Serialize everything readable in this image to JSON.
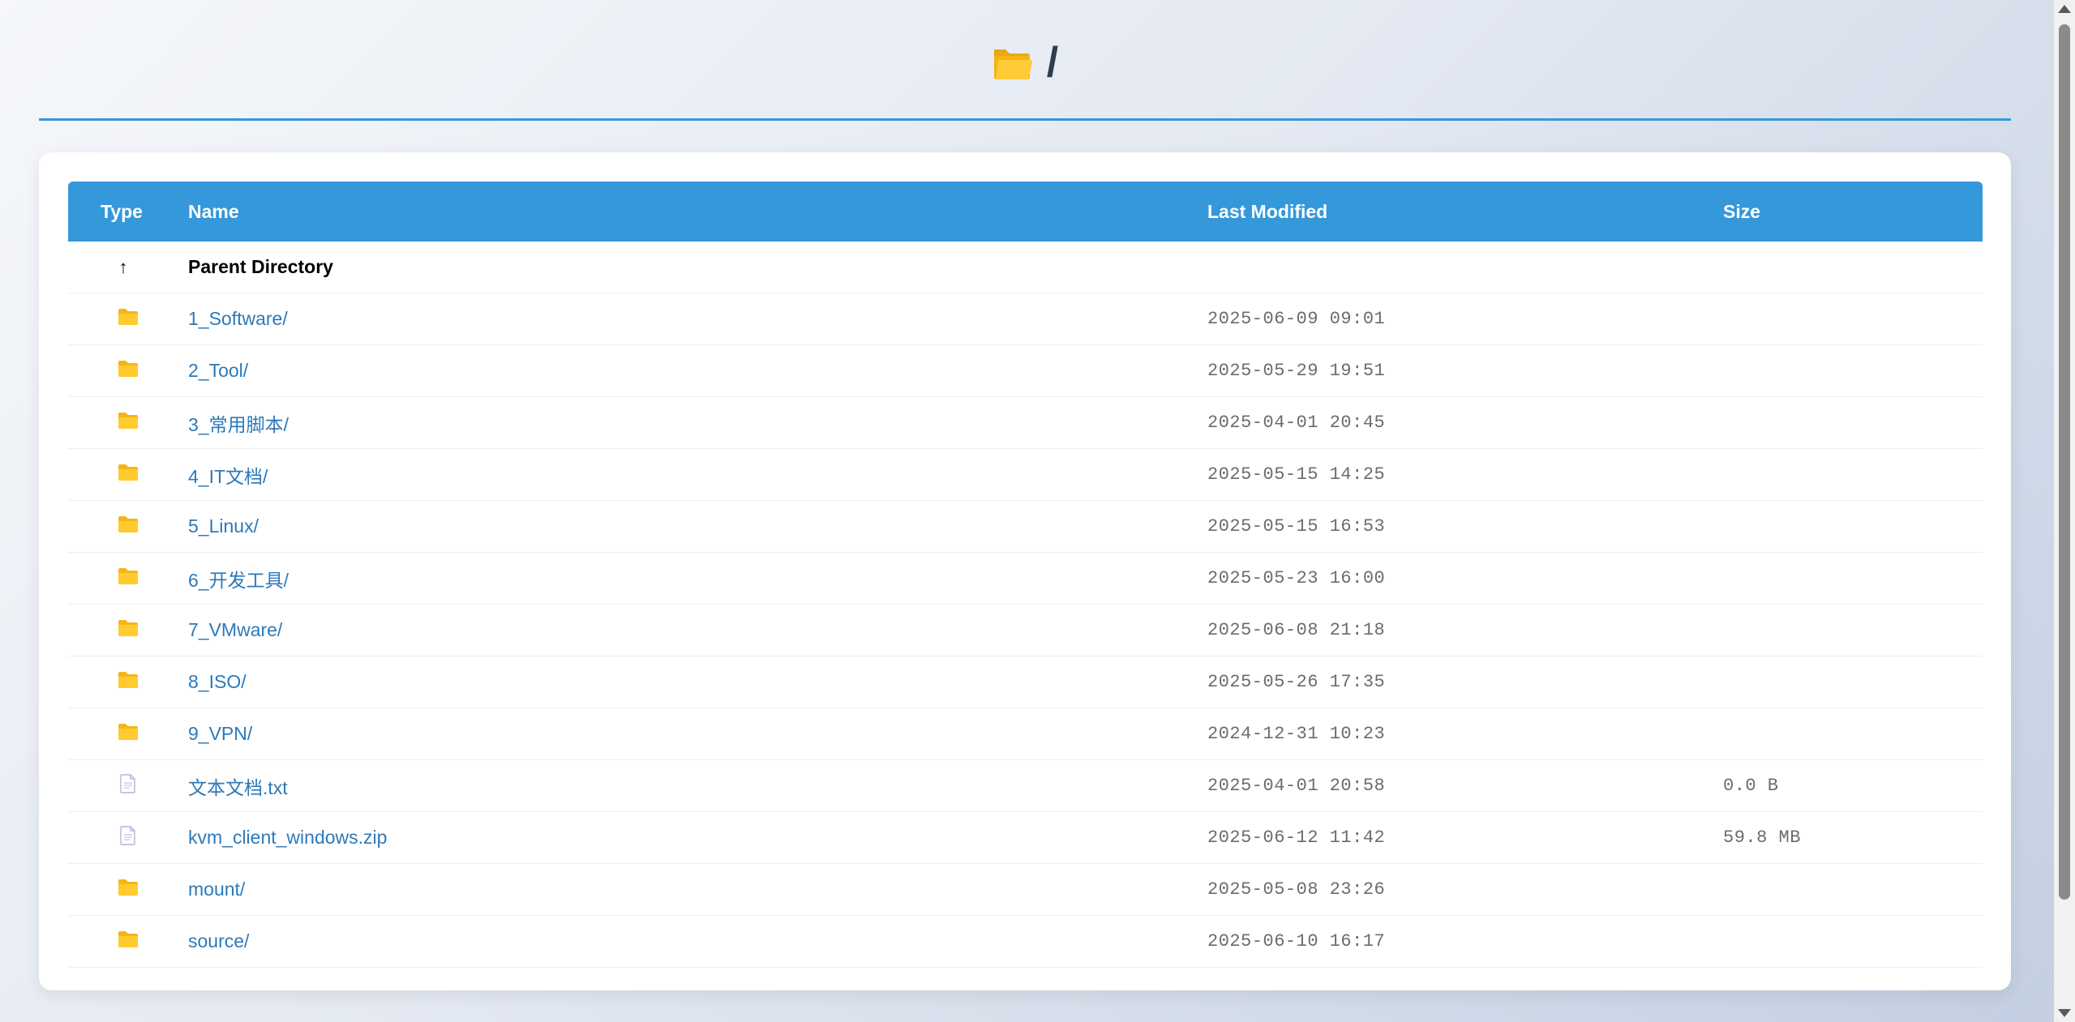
{
  "header": {
    "icon": "open-folder-icon",
    "title": "/"
  },
  "table": {
    "columns": {
      "type": "Type",
      "name": "Name",
      "modified": "Last Modified",
      "size": "Size"
    },
    "parent": {
      "icon": "↑",
      "label": "Parent Directory"
    },
    "rows": [
      {
        "icon": "folder-icon",
        "name": "1_Software/",
        "modified": "2025-06-09 09:01",
        "size": ""
      },
      {
        "icon": "folder-icon",
        "name": "2_Tool/",
        "modified": "2025-05-29 19:51",
        "size": ""
      },
      {
        "icon": "folder-icon",
        "name": "3_常用脚本/",
        "modified": "2025-04-01 20:45",
        "size": ""
      },
      {
        "icon": "folder-icon",
        "name": "4_IT文档/",
        "modified": "2025-05-15 14:25",
        "size": ""
      },
      {
        "icon": "folder-icon",
        "name": "5_Linux/",
        "modified": "2025-05-15 16:53",
        "size": ""
      },
      {
        "icon": "folder-icon",
        "name": "6_开发工具/",
        "modified": "2025-05-23 16:00",
        "size": ""
      },
      {
        "icon": "folder-icon",
        "name": "7_VMware/",
        "modified": "2025-06-08 21:18",
        "size": ""
      },
      {
        "icon": "folder-icon",
        "name": "8_ISO/",
        "modified": "2025-05-26 17:35",
        "size": ""
      },
      {
        "icon": "folder-icon",
        "name": "9_VPN/",
        "modified": "2024-12-31 10:23",
        "size": ""
      },
      {
        "icon": "file-icon",
        "name": "文本文档.txt",
        "modified": "2025-04-01 20:58",
        "size": "0.0 B"
      },
      {
        "icon": "file-icon",
        "name": "kvm_client_windows.zip",
        "modified": "2025-06-12 11:42",
        "size": "59.8 MB"
      },
      {
        "icon": "folder-icon",
        "name": "mount/",
        "modified": "2025-05-08 23:26",
        "size": ""
      },
      {
        "icon": "folder-icon",
        "name": "source/",
        "modified": "2025-06-10 16:17",
        "size": ""
      }
    ]
  },
  "colors": {
    "accent": "#3498db",
    "link": "#2d79b9",
    "folder": "#ffc928",
    "file": "#b9b2d8"
  }
}
